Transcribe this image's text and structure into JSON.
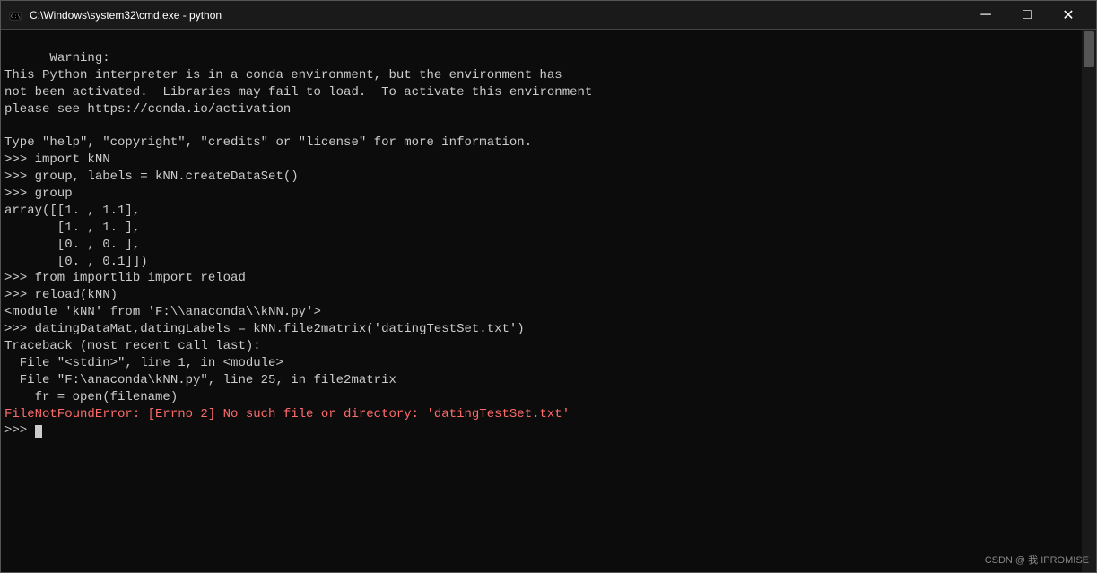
{
  "titleBar": {
    "icon": "cmd-icon",
    "title": "C:\\Windows\\system32\\cmd.exe - python",
    "minimizeLabel": "─",
    "maximizeLabel": "□",
    "closeLabel": "✕"
  },
  "console": {
    "lines": [
      {
        "type": "warning",
        "text": "Warning:"
      },
      {
        "type": "warning",
        "text": "This Python interpreter is in a conda environment, but the environment has"
      },
      {
        "type": "warning",
        "text": "not been activated.  Libraries may fail to load.  To activate this environment"
      },
      {
        "type": "warning",
        "text": "please see https://conda.io/activation"
      },
      {
        "type": "normal",
        "text": ""
      },
      {
        "type": "normal",
        "text": "Type \"help\", \"copyright\", \"credits\" or \"license\" for more information."
      },
      {
        "type": "prompt",
        "text": ">>> import kNN"
      },
      {
        "type": "prompt",
        "text": ">>> group, labels = kNN.createDataSet()"
      },
      {
        "type": "prompt",
        "text": ">>> group"
      },
      {
        "type": "normal",
        "text": "array([[1. , 1.1],"
      },
      {
        "type": "normal",
        "text": "       [1. , 1. ],"
      },
      {
        "type": "normal",
        "text": "       [0. , 0. ],"
      },
      {
        "type": "normal",
        "text": "       [0. , 0.1]])"
      },
      {
        "type": "prompt",
        "text": ">>> from importlib import reload"
      },
      {
        "type": "prompt",
        "text": ">>> reload(kNN)"
      },
      {
        "type": "normal",
        "text": "<module 'kNN' from 'F:\\\\anaconda\\\\kNN.py'>"
      },
      {
        "type": "prompt",
        "text": ">>> datingDataMat,datingLabels = kNN.file2matrix('datingTestSet.txt')"
      },
      {
        "type": "normal",
        "text": "Traceback (most recent call last):"
      },
      {
        "type": "normal",
        "text": "  File \"<stdin>\", line 1, in <module>"
      },
      {
        "type": "normal",
        "text": "  File \"F:\\anaconda\\kNN.py\", line 25, in file2matrix"
      },
      {
        "type": "normal",
        "text": "    fr = open(filename)"
      },
      {
        "type": "error",
        "text": "FileNotFoundError: [Errno 2] No such file or directory: 'datingTestSet.txt'"
      },
      {
        "type": "prompt",
        "text": ">>> "
      }
    ]
  },
  "watermark": {
    "text": "CSDN @ 我 IPROMISE"
  }
}
